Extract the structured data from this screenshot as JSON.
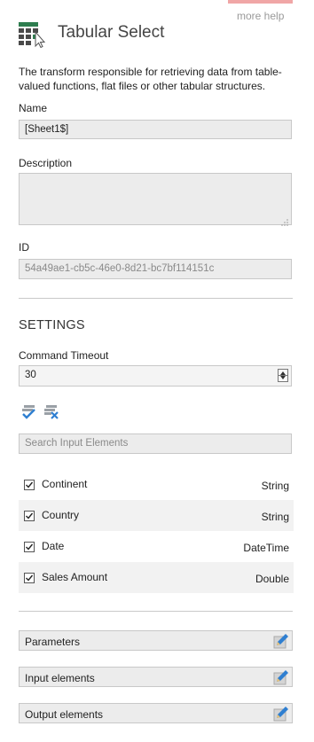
{
  "header": {
    "more_help": "more help",
    "title": "Tabular Select",
    "description": "The transform responsible for retrieving data from table-valued functions, flat files or other tabular structures."
  },
  "fields": {
    "name_label": "Name",
    "name_value": "[Sheet1$]",
    "description_label": "Description",
    "description_value": "",
    "id_label": "ID",
    "id_value": "54a49ae1-cb5c-46e0-8d21-bc7bf114151c"
  },
  "settings": {
    "title": "SETTINGS",
    "command_timeout_label": "Command Timeout",
    "command_timeout_value": "30",
    "search_placeholder": "Search Input Elements"
  },
  "elements": [
    {
      "name": "Continent",
      "type": "String",
      "checked": true
    },
    {
      "name": "Country",
      "type": "String",
      "checked": true
    },
    {
      "name": "Date",
      "type": "DateTime",
      "checked": true
    },
    {
      "name": "Sales Amount",
      "type": "Double",
      "checked": true
    }
  ],
  "panels": {
    "parameters": "Parameters",
    "input_elements": "Input elements",
    "output_elements": "Output elements"
  },
  "colors": {
    "accent_strip": "#f0a6a6",
    "logo_green": "#2e7d4f",
    "icon_blue": "#2f7fd1"
  }
}
